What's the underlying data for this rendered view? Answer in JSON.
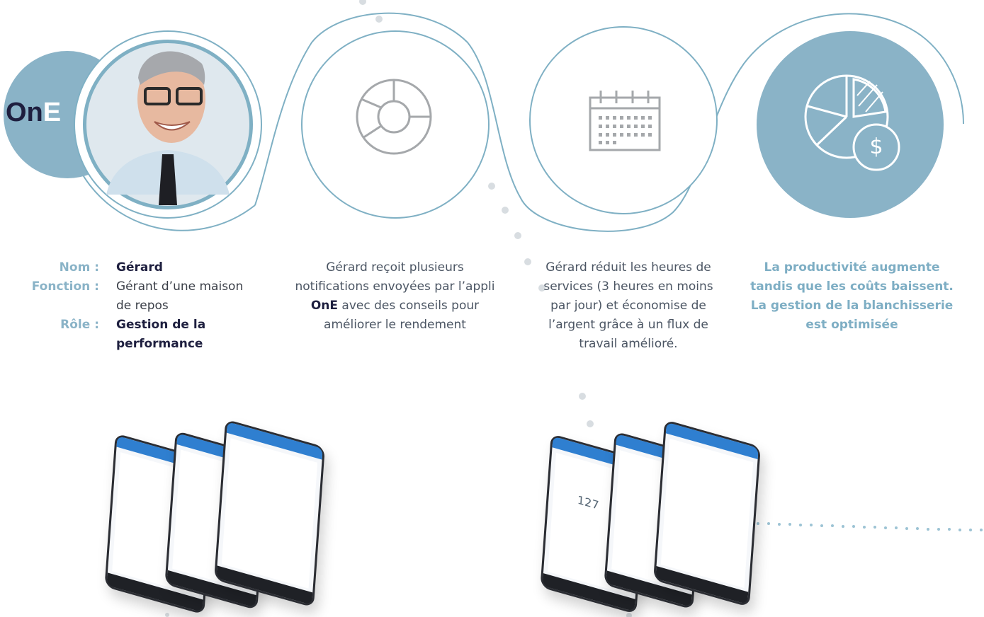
{
  "brand": {
    "logo_text_on": "On",
    "logo_text_e": "E"
  },
  "profile": {
    "name_label": "Nom :",
    "name_value": "Gérard",
    "function_label": "Fonction :",
    "function_value": "Gérant d’une maison de repos",
    "role_label": "Rôle :",
    "role_value": "Gestion de la performance"
  },
  "step2": {
    "text_before": "Gérard reçoit plusieurs notifications envoyées par l’appli ",
    "text_bold": "OnE",
    "text_after": " avec des conseils pour améliorer le rendement"
  },
  "step3": {
    "text": "Gérard réduit les heures de services (3 heures en moins par jour) et économise de l’argent grâce à un flux de travail amélioré."
  },
  "step4": {
    "line1": "La productivité augmente tandis que les coûts baissent.",
    "line2": "La gestion de la blanchisserie est optimisée"
  },
  "icons": {
    "step1": "person-photo",
    "step2": "donut-chart-icon",
    "step3": "calendar-icon",
    "step4": "pie-chart-dollar-icon"
  },
  "phone_screens": {
    "left_group": [
      "app-screen-1",
      "app-screen-2",
      "app-screen-3"
    ],
    "right_group": [
      "app-screen-4",
      "app-screen-5",
      "app-screen-6"
    ],
    "gauge_value": "127"
  },
  "colors": {
    "accent_blue": "#8ab3c7",
    "dark_navy": "#1e1f3f",
    "line_blue": "#7fb0c4",
    "text_gray": "#4b5563"
  }
}
